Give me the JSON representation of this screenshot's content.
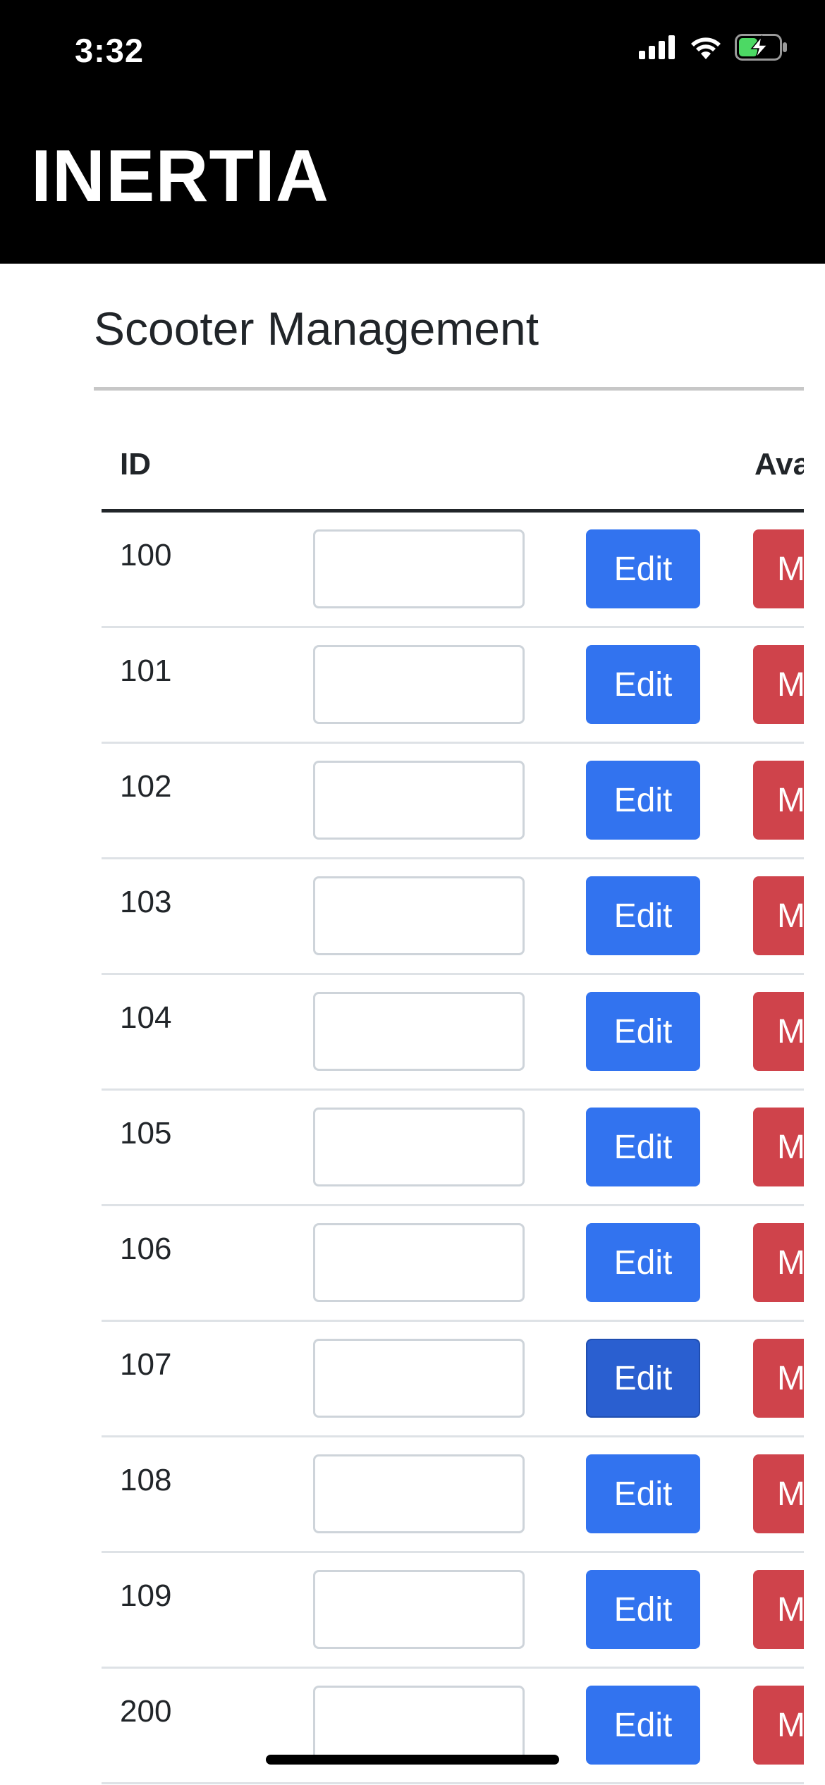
{
  "status_bar": {
    "time": "3:32",
    "icons": [
      "cellular-signal-icon",
      "wifi-icon",
      "battery-charging-icon"
    ],
    "battery_color": "#4cd964"
  },
  "app": {
    "brand": "INERTIA"
  },
  "page": {
    "title": "Scooter Management"
  },
  "table": {
    "headers": {
      "id": "ID",
      "availability": "Ava"
    },
    "edit_label": "Edit",
    "second_action_label": "M",
    "rows": [
      {
        "id": "100",
        "input_value": ""
      },
      {
        "id": "101",
        "input_value": ""
      },
      {
        "id": "102",
        "input_value": ""
      },
      {
        "id": "103",
        "input_value": ""
      },
      {
        "id": "104",
        "input_value": ""
      },
      {
        "id": "105",
        "input_value": ""
      },
      {
        "id": "106",
        "input_value": ""
      },
      {
        "id": "107",
        "input_value": "",
        "edit_pressed": true
      },
      {
        "id": "108",
        "input_value": ""
      },
      {
        "id": "109",
        "input_value": ""
      },
      {
        "id": "200",
        "input_value": ""
      }
    ]
  },
  "colors": {
    "header_bg": "#000000",
    "edit_button": "#3273ef",
    "edit_button_pressed": "#2a5fd0",
    "m_button": "#cf434b",
    "text": "#212529"
  }
}
